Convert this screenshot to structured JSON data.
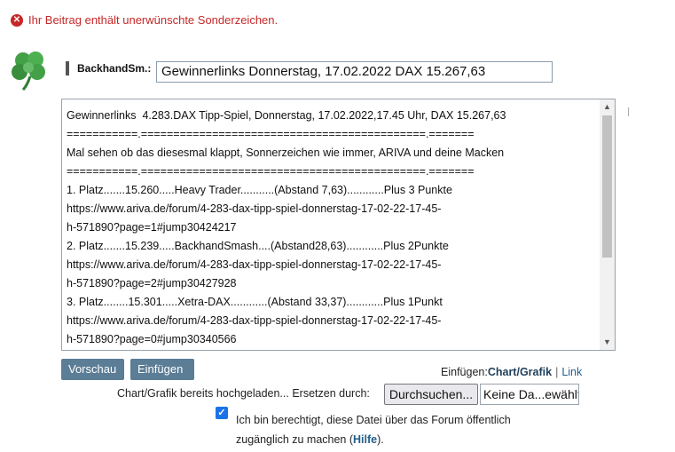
{
  "error": {
    "icon": "error-circle-icon",
    "message": "Ihr Beitrag enthält unerwünschte Sonderzeichen."
  },
  "author": {
    "icon": "clover-icon",
    "name": "BackhandSm.:"
  },
  "post_title": {
    "value": "Gewinnerlinks Donnerstag, 17.02.2022 DAX 15.267,63"
  },
  "editor": {
    "lines": [
      "Gewinnerlinks  4.283.DAX Tipp-Spiel, Donnerstag, 17.02.2022,17.45 Uhr, DAX 15.267,63",
      "===========.============================================.=======",
      "Mal sehen ob das diesesmal klappt, Sonnerzeichen wie immer, ARIVA und deine Macken",
      "===========.============================================.=======",
      "1. Platz.......15.260.....Heavy Trader...........(Abstand 7,63)............Plus 3 Punkte",
      "https://www.ariva.de/forum/4-283-dax-tipp-spiel-donnerstag-17-02-22-17-45-",
      "h-571890?page=1#jump30424217",
      "2. Platz.......15.239.....BackhandSmash....(Abstand28,63)............Plus 2Punkte",
      "https://www.ariva.de/forum/4-283-dax-tipp-spiel-donnerstag-17-02-22-17-45-",
      "h-571890?page=2#jump30427928",
      "3. Platz........15.301.....Xetra-DAX............(Abstand 33,37)............Plus 1Punkt",
      "https://www.ariva.de/forum/4-283-dax-tipp-spiel-donnerstag-17-02-22-17-45-",
      "h-571890?page=0#jump30340566"
    ]
  },
  "buttons": {
    "preview": "Vorschau",
    "insert": "Einfügen"
  },
  "insert_options": {
    "label": "Einfügen:",
    "chart": "Chart/Grafik",
    "separator": "|",
    "link": "Link"
  },
  "upload": {
    "label": "Chart/Grafik bereits hochgeladen... Ersetzen durch:",
    "browse": "Durchsuchen...",
    "file_status": "Keine Da...ewählt."
  },
  "permission": {
    "checked": true,
    "text": "Ich bin berechtigt, diese Datei über das Forum öffentlich zugänglich zu machen (",
    "help": "Hilfe",
    "suffix": ")."
  }
}
